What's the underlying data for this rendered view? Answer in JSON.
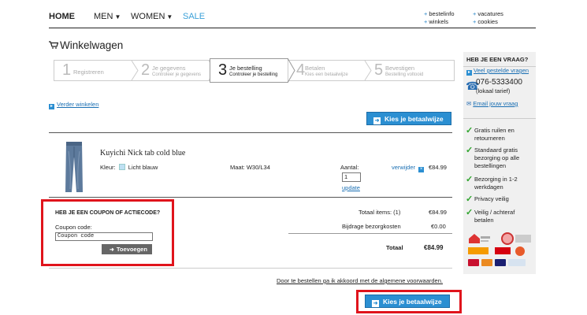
{
  "nav": {
    "home": "HOME",
    "men": "MEN",
    "women": "WOMEN",
    "sale": "SALE",
    "links_left": [
      "bestelinfo",
      "winkels"
    ],
    "links_right": [
      "vacatures",
      "cookies"
    ]
  },
  "page_title": "Winkelwagen",
  "steps": [
    {
      "num": "1",
      "title": "Registreren",
      "sub": ""
    },
    {
      "num": "2",
      "title": "Je gegevens",
      "sub": "Controleer je gegevens"
    },
    {
      "num": "3",
      "title": "Je bestelling",
      "sub": "Controleer je bestelling"
    },
    {
      "num": "4",
      "title": "Betalen",
      "sub": "Kies een betaalwijze"
    },
    {
      "num": "5",
      "title": "Bevestigen",
      "sub": "Bestelling voltooid"
    }
  ],
  "continue_shopping": "Verder winkelen",
  "pay_button": "Kies je betaalwijze",
  "product": {
    "name": "Kuyichi Nick tab cold blue",
    "color_label": "Kleur:",
    "color_value": "Licht blauw",
    "size": "Maat: W30/L34",
    "qty_label": "Aantal:",
    "qty_value": "1",
    "update": "update",
    "remove": "verwijder",
    "price": "€84.99"
  },
  "coupon": {
    "heading": "HEB JE EEN COUPON OF ACTIECODE?",
    "label": "Coupon code:",
    "placeholder": "Coupon code",
    "button": "Toevoegen"
  },
  "totals": {
    "items_label": "Totaal items: (1)",
    "items_value": "€84.99",
    "shipping_label": "Bijdrage bezorgkosten",
    "shipping_value": "€0.00",
    "total_label": "Totaal",
    "total_value": "€84.99"
  },
  "terms": "Door te bestellen ga ik akkoord met de algemene voorwaarden.",
  "sidebar": {
    "heading": "HEB JE EEN VRAAG?",
    "faq": "Veel gestelde vragen",
    "phone": "076-5333400",
    "phone_note": "(lokaal tarief)",
    "email": "Email jouw vraag",
    "usps": [
      "Gratis ruilen en retourneren",
      "Standaard gratis bezorging op alle bestellingen",
      "Bezorging in 1-2 werkdagen",
      "Privacy veilig",
      "Veilig / achteraf betalen"
    ]
  },
  "colors": {
    "accent": "#2b8fd2",
    "highlight": "#e0141c",
    "check": "#2ea42c"
  }
}
